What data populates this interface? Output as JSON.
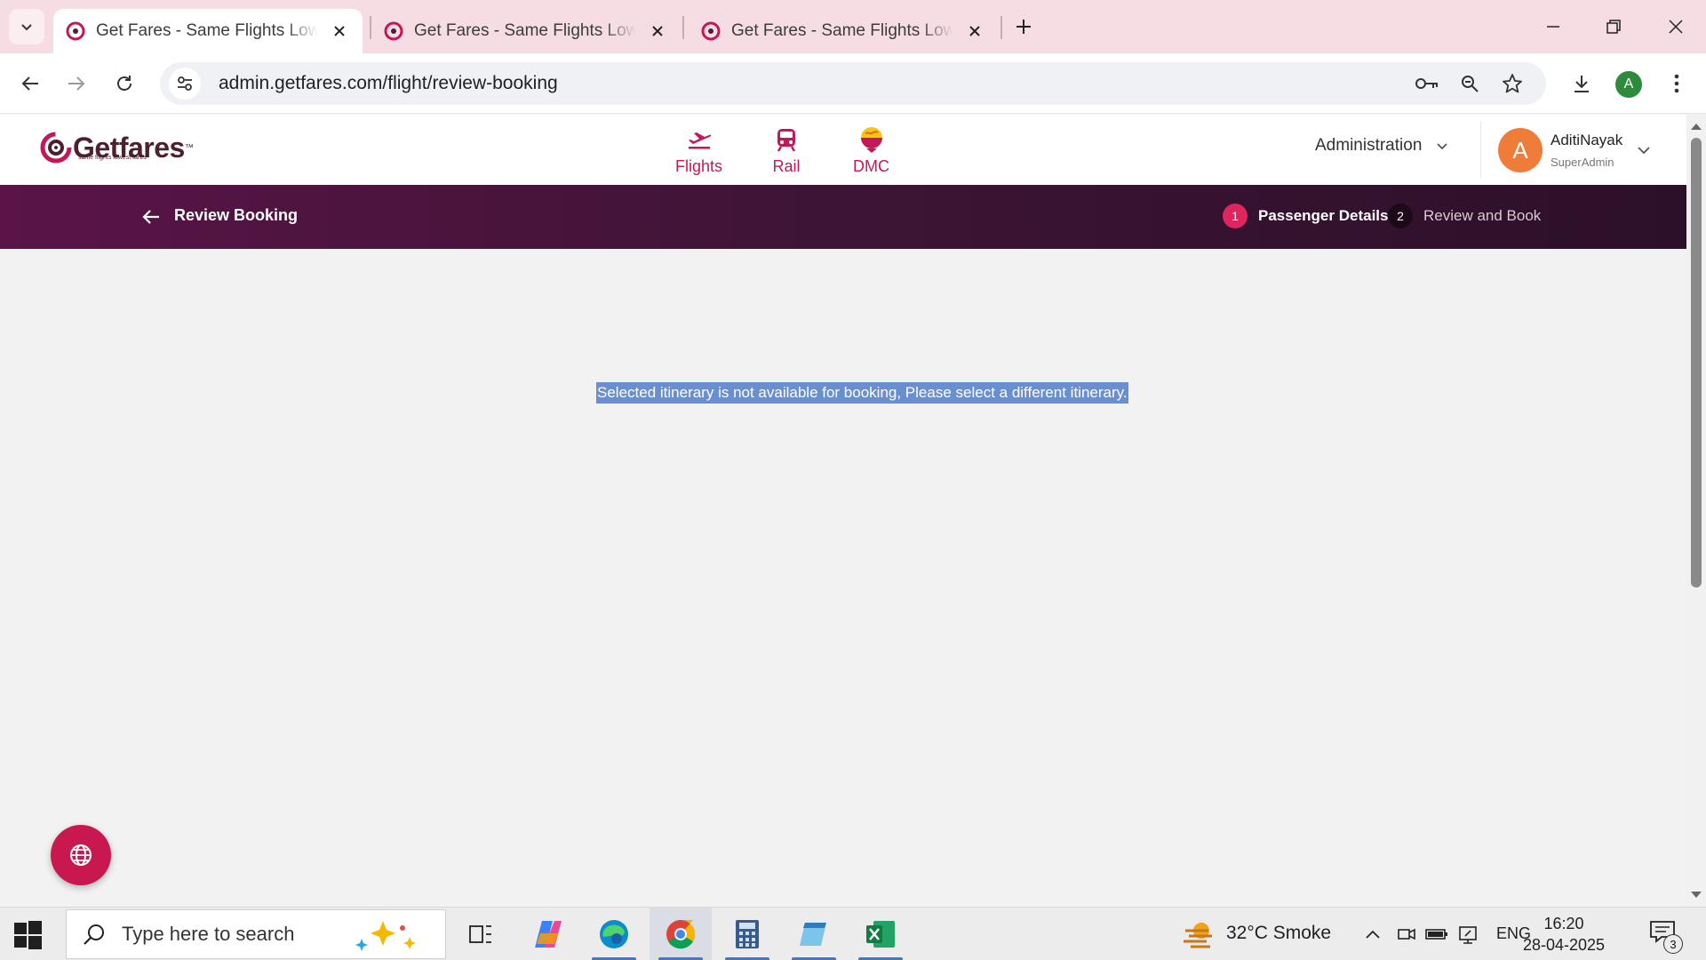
{
  "browser": {
    "tabs": [
      {
        "title": "Get Fares - Same Flights Lowest Fares",
        "active": true
      },
      {
        "title": "Get Fares - Same Flights Lowest Fares",
        "active": false
      },
      {
        "title": "Get Fares - Same Flights Lowest Fares",
        "active": false
      }
    ],
    "url": "admin.getfares.com/flight/review-booking",
    "profile_initial": "A"
  },
  "site": {
    "logo_text": "Getfares",
    "logo_tm": "™",
    "logo_tagline": "same flights lowest fares",
    "modules": [
      {
        "label": "Flights",
        "icon": "plane-icon"
      },
      {
        "label": "Rail",
        "icon": "train-icon"
      },
      {
        "label": "DMC",
        "icon": "dmc-globe-icon"
      }
    ],
    "admin_menu_label": "Administration",
    "user": {
      "initial": "A",
      "name": "AditiNayak",
      "role": "SuperAdmin"
    }
  },
  "banner": {
    "title": "Review Booking",
    "steps": [
      {
        "num": "1",
        "label": "Passenger Details",
        "state": "active"
      },
      {
        "num": "2",
        "label": "Review and Book",
        "state": "inactive"
      }
    ]
  },
  "content": {
    "message": "Selected itinerary is not available for booking, Please select a different itinerary."
  },
  "taskbar": {
    "search_placeholder": "Type here to search",
    "weather": "32°C  Smoke",
    "language": "ENG",
    "time": "16:20",
    "date": "28-04-2025",
    "notification_count": "3"
  },
  "colors": {
    "brand": "#c2185b",
    "banner_dark": "#3d1435",
    "step_active": "#e0245e",
    "selection": "#6a8fd0"
  }
}
